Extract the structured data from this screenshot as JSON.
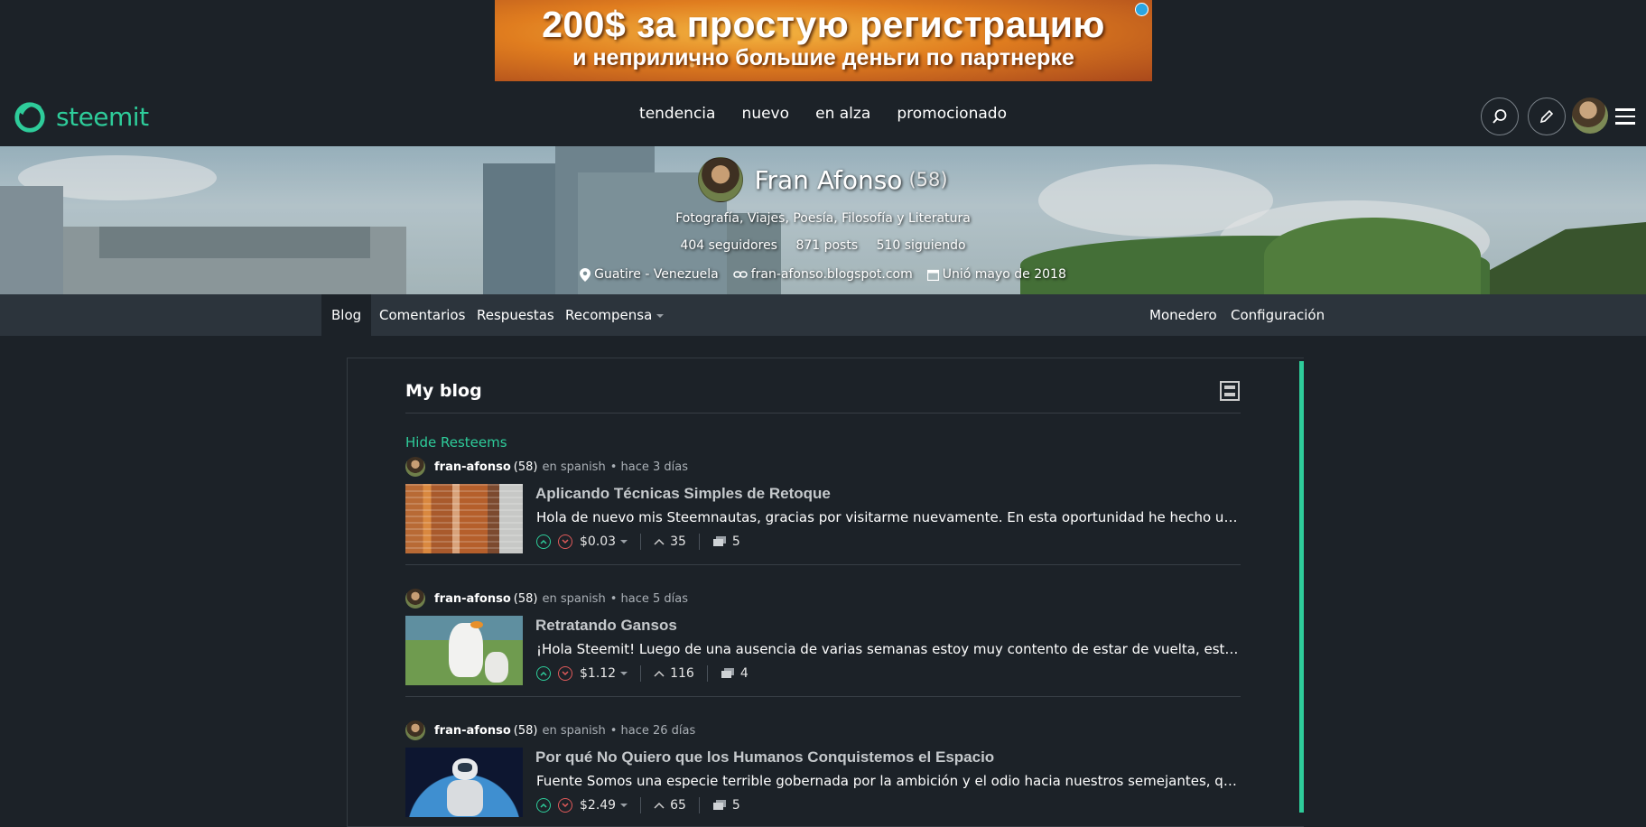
{
  "ad": {
    "line1": "200$ за простую регистрацию",
    "line2": "и неприлично большие деньги по партнерке"
  },
  "header": {
    "logo_text": "steemit",
    "nav": [
      "tendencia",
      "nuevo",
      "en alza",
      "promocionado"
    ]
  },
  "profile": {
    "name": "Fran Afonso",
    "reputation": "(58)",
    "about": "Fotografía, Viajes, Poesía, Filosofía y Literatura",
    "followers": "404 seguidores",
    "posts": "871 posts",
    "following": "510 siguiendo",
    "location": "Guatire - Venezuela",
    "website": "fran-afonso.blogspot.com",
    "joined": "Unió mayo de 2018"
  },
  "subnav": {
    "left": [
      "Blog",
      "Comentarios",
      "Respuestas",
      "Recompensa"
    ],
    "right": [
      "Monedero",
      "Configuración"
    ],
    "active": "Blog"
  },
  "blog": {
    "title": "My blog",
    "hide_resteems": "Hide Resteems",
    "posts": [
      {
        "author": "fran-afonso",
        "rep": "(58)",
        "category": "en spanish",
        "time": "• hace 3 días",
        "title": "Aplicando Técnicas Simples de Retoque",
        "desc": "Hola de nuevo mis Steemnautas, gracias por visitarme nuevamente. En esta oportunidad he hecho un pequeño Retoque de una fotografía de edificios",
        "payout": "$0.03",
        "votes": "35",
        "comments": "5"
      },
      {
        "author": "fran-afonso",
        "rep": "(58)",
        "category": "en spanish",
        "time": "• hace 5 días",
        "title": "Retratando Gansos",
        "desc": "¡Hola Steemit! Luego de una ausencia de varias semanas estoy muy contento de estar de vuelta, estuve trabajando en varios proyectos",
        "payout": "$1.12",
        "votes": "116",
        "comments": "4"
      },
      {
        "author": "fran-afonso",
        "rep": "(58)",
        "category": "en spanish",
        "time": "• hace 26 días",
        "title": "Por qué No Quiero que los Humanos Conquistemos el Espacio",
        "desc": "Fuente Somos una especie terrible gobernada por la ambición y el odio hacia nuestros semejantes, quizás creamos que la conquista del espacio",
        "payout": "$2.49",
        "votes": "65",
        "comments": "5"
      }
    ]
  },
  "colors": {
    "background": "#1c2228",
    "accent": "#2ecc9a",
    "subnav": "#2c343c",
    "downvote": "#e05a5a"
  }
}
